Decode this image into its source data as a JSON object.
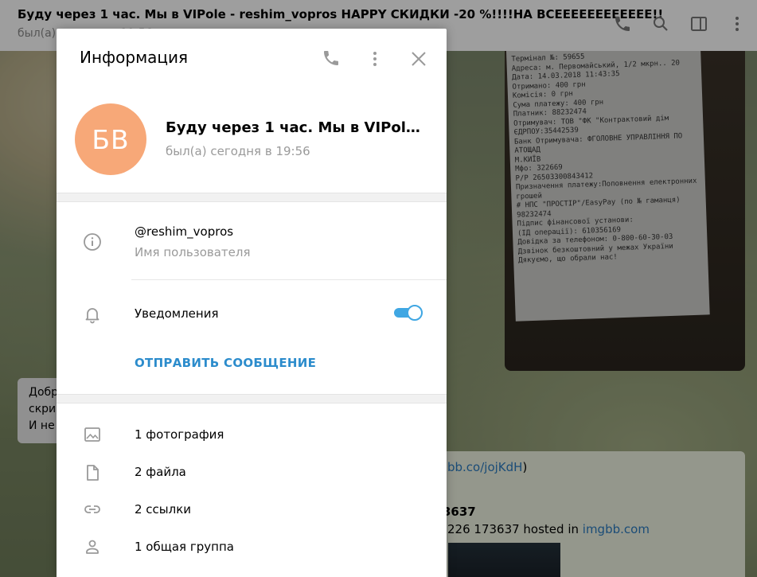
{
  "chat": {
    "title": "Буду через 1 час. Мы в VIPole - reshim_vopros HAPPY СКИДКИ -20 %!!!!НА ВСЕЕЕЕЕЕЕЕЕЕЕЕ!!",
    "status": "был(а) сегодня в 19:56",
    "incoming_lines": [
      "Добр",
      "скри",
      "И не"
    ],
    "outgoing_link_suffix": "bb.co/jojKdH",
    "outgoing_link_close": ")",
    "outgoing_bold": "3637",
    "outgoing_text_prefix": "226 173637 hosted in ",
    "outgoing_host": "imgbb.com",
    "receipt_lines": [
      "Термінал №: 59655",
      "Адреса: м. Первомайський, 1/2 мкрн.. 20",
      "Дата: 14.03.2018 11:43:35",
      "Отримано: 400 грн",
      "Комісія: 0 грн",
      "Сума платежу: 400 грн",
      "Платник: 88232474",
      "Отримувач: ТОВ \"ФК \"Контрактовий дім",
      "ЄДРПОУ:35442539",
      "Банк Отримувача: ФГОЛОВНЕ УПРАВЛІННЯ ПО  АТОЩАД",
      "М.КИЇВ",
      "Мфо:  322669",
      "Р/Р 26503300843412",
      "Призначення платежу:Поповнення електронних грошей",
      "# НПС \"ПРОСТІР\"/EasyPay (по № гаманця) 98232474",
      "Підпис фінансової установи:",
      "(ІД операції): 610356169",
      "Довідка за телефоном: 0-800-60-30-03",
      "Дзвінок безкоштовний у межах України",
      "Дякуємо, що обрали нас!"
    ]
  },
  "modal": {
    "title": "Информация",
    "avatar_initials": "БВ",
    "name": "Буду через 1 час. Мы в VIPole - reshim_vopros HAPPY СКИДКИ -20 %!!!!НА ВСЕЕЕЕЕЕЕЕЕЕЕЕ!!",
    "status": "был(а) сегодня в 19:56",
    "username": "@reshim_vopros",
    "username_label": "Имя пользователя",
    "notifications_label": "Уведомления",
    "notifications_on": true,
    "send_message": "ОТПРАВИТЬ СООБЩЕНИЕ",
    "media": [
      {
        "icon": "photo-icon",
        "label": "1 фотография"
      },
      {
        "icon": "file-icon",
        "label": "2 файла"
      },
      {
        "icon": "link-icon",
        "label": "2 ссылки"
      },
      {
        "icon": "group-icon",
        "label": "1 общая группа"
      }
    ]
  },
  "colors": {
    "accent": "#40a7e3",
    "send_button": "#2c8ccc",
    "avatar_bg": "#f7a878",
    "secondary_text": "#9a9a9a"
  }
}
